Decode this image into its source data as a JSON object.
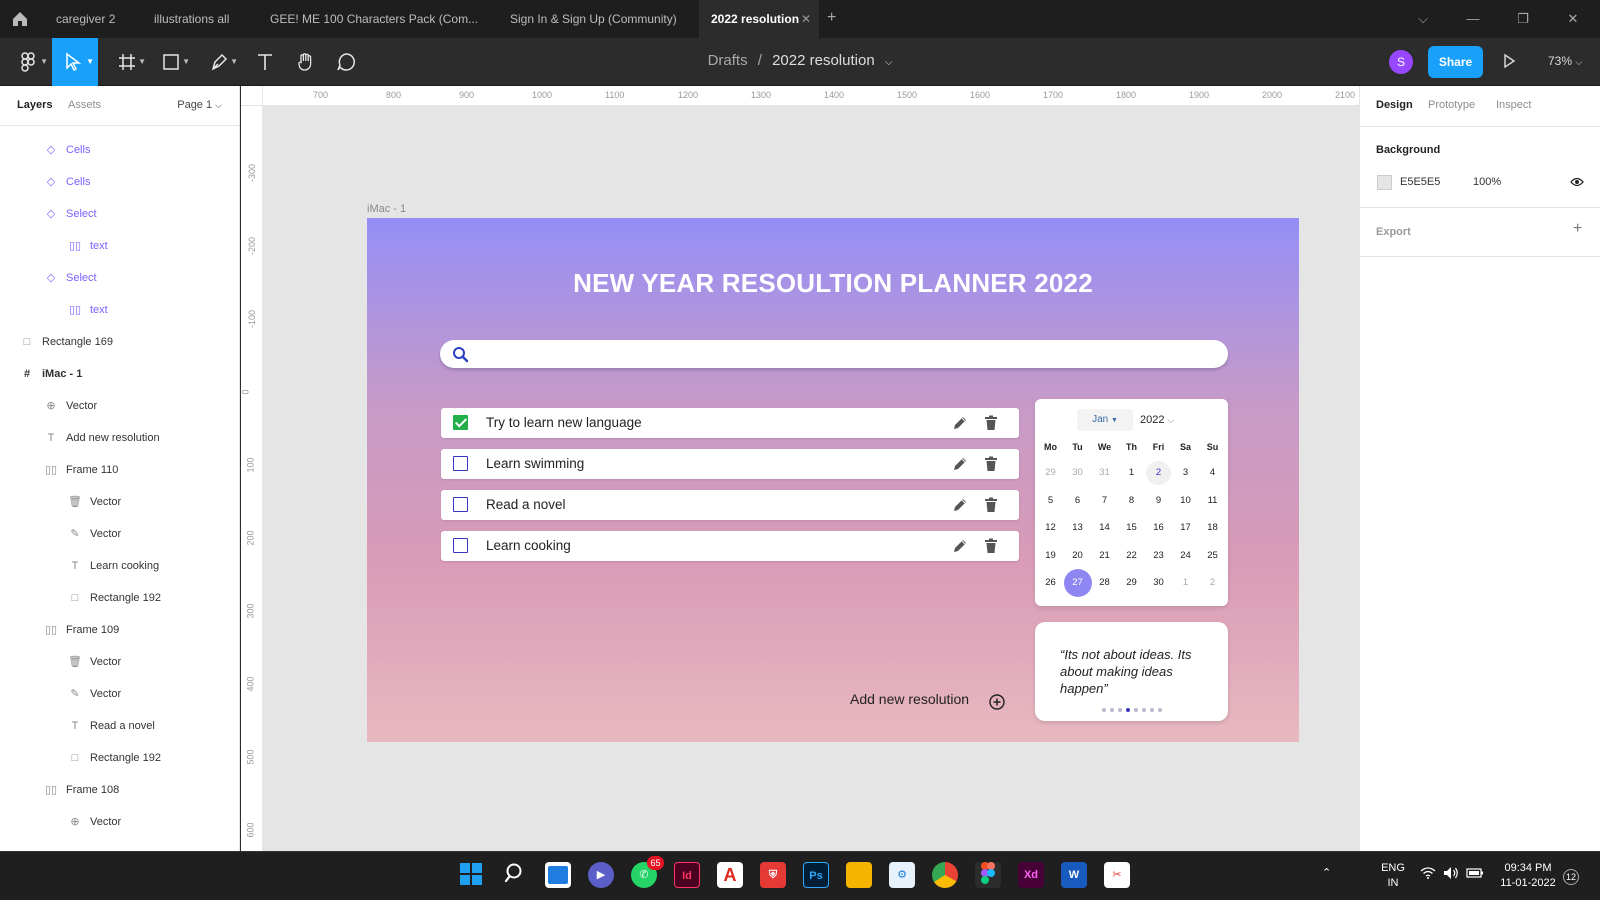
{
  "tabs": [
    {
      "label": "caregiver 2"
    },
    {
      "label": "illustrations all"
    },
    {
      "label": "GEE! ME 100 Characters Pack (Com..."
    },
    {
      "label": "Sign In & Sign Up (Community)"
    },
    {
      "label": "2022 resolution"
    }
  ],
  "window": {
    "minimize": "—",
    "restore": "❐",
    "close": "✕",
    "dropdown": "⌵"
  },
  "toolbar": {
    "breadcrumb_parent": "Drafts",
    "breadcrumb_sep": "/",
    "file_name": "2022 resolution",
    "avatar": "S",
    "share": "Share",
    "zoom": "73%"
  },
  "layers_panel": {
    "tab_layers": "Layers",
    "tab_assets": "Assets",
    "page": "Page 1",
    "items": [
      {
        "label": "Cells",
        "icon": "component-icon"
      },
      {
        "label": "Cells",
        "icon": "component-icon"
      },
      {
        "label": "Select",
        "icon": "component-icon"
      },
      {
        "label": "text",
        "icon": "autolayout-icon"
      },
      {
        "label": "Select",
        "icon": "component-icon"
      },
      {
        "label": "text",
        "icon": "autolayout-icon"
      },
      {
        "label": "Rectangle 169",
        "icon": "rectangle-icon"
      },
      {
        "label": "iMac - 1",
        "icon": "frame-icon"
      },
      {
        "label": "Vector",
        "icon": "vector-icon"
      },
      {
        "label": "Add new resolution",
        "icon": "text-icon"
      },
      {
        "label": "Frame 110",
        "icon": "autolayout-icon"
      },
      {
        "label": "Vector",
        "icon": "vector-icon"
      },
      {
        "label": "Vector",
        "icon": "vector-icon"
      },
      {
        "label": "Learn cooking",
        "icon": "text-icon"
      },
      {
        "label": "Rectangle 192",
        "icon": "rectangle-icon"
      },
      {
        "label": "Frame 109",
        "icon": "autolayout-icon"
      },
      {
        "label": "Vector",
        "icon": "vector-icon"
      },
      {
        "label": "Vector",
        "icon": "vector-icon"
      },
      {
        "label": "Read a novel",
        "icon": "text-icon"
      },
      {
        "label": "Rectangle 192",
        "icon": "rectangle-icon"
      },
      {
        "label": "Frame 108",
        "icon": "autolayout-icon"
      },
      {
        "label": "Vector",
        "icon": "vector-icon"
      }
    ]
  },
  "ruler": {
    "h": [
      "700",
      "800",
      "900",
      "1000",
      "1100",
      "1200",
      "1300",
      "1400",
      "1500",
      "1600",
      "1700",
      "1800",
      "1900",
      "2000",
      "2100"
    ],
    "v": [
      "-300",
      "-200",
      "-100",
      "0",
      "100",
      "200",
      "300",
      "400",
      "500",
      "600"
    ]
  },
  "frame": {
    "label": "iMac - 1",
    "title": "NEW YEAR RESOULTION PLANNER 2022",
    "todos": [
      {
        "text": "Try to learn new language",
        "checked": true
      },
      {
        "text": "Learn swimming",
        "checked": false
      },
      {
        "text": "Read a novel",
        "checked": false
      },
      {
        "text": "Learn cooking",
        "checked": false
      }
    ],
    "calendar": {
      "month": "Jan",
      "year": "2022",
      "weekdays": [
        "Mo",
        "Tu",
        "We",
        "Th",
        "Fri",
        "Sa",
        "Su"
      ],
      "days": [
        "29",
        "30",
        "31",
        "1",
        "2",
        "3",
        "4",
        "5",
        "6",
        "7",
        "8",
        "9",
        "10",
        "11",
        "12",
        "13",
        "14",
        "15",
        "16",
        "17",
        "18",
        "19",
        "20",
        "21",
        "22",
        "23",
        "24",
        "25",
        "26",
        "27",
        "28",
        "29",
        "30",
        "1",
        "2"
      ],
      "muted_days": [
        0,
        1,
        2,
        33,
        34
      ],
      "highlight_day": "2",
      "selected_day": "27"
    },
    "quote": "“Its not about ideas. Its about making ideas happen”",
    "carousel_count": 8,
    "carousel_active": 3,
    "add_new": "Add new resolution"
  },
  "design_panel": {
    "tab_design": "Design",
    "tab_prototype": "Prototype",
    "tab_inspect": "Inspect",
    "background_heading": "Background",
    "bg_hex": "E5E5E5",
    "bg_opacity": "100%",
    "export_heading": "Export"
  },
  "help": "?",
  "taskbar": {
    "whatsapp_badge": "65",
    "lang_top": "ENG",
    "lang_bottom": "IN",
    "time": "09:34 PM",
    "date": "11-01-2022",
    "notifications": "12"
  },
  "colors": {
    "accent": "#18a0fb",
    "component": "#7b61ff",
    "check": "#22b04b",
    "calendar_selected": "#8e87f2"
  }
}
